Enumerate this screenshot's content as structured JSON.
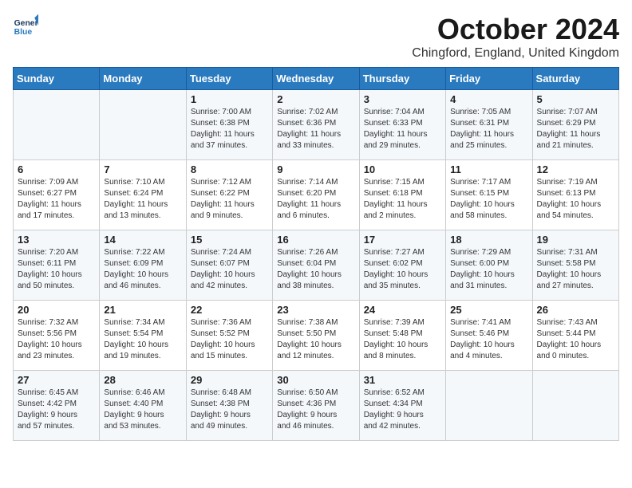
{
  "logo": {
    "line1": "General",
    "line2": "Blue"
  },
  "title": "October 2024",
  "location": "Chingford, England, United Kingdom",
  "days_of_week": [
    "Sunday",
    "Monday",
    "Tuesday",
    "Wednesday",
    "Thursday",
    "Friday",
    "Saturday"
  ],
  "weeks": [
    [
      {
        "day": "",
        "info": ""
      },
      {
        "day": "",
        "info": ""
      },
      {
        "day": "1",
        "info": "Sunrise: 7:00 AM\nSunset: 6:38 PM\nDaylight: 11 hours\nand 37 minutes."
      },
      {
        "day": "2",
        "info": "Sunrise: 7:02 AM\nSunset: 6:36 PM\nDaylight: 11 hours\nand 33 minutes."
      },
      {
        "day": "3",
        "info": "Sunrise: 7:04 AM\nSunset: 6:33 PM\nDaylight: 11 hours\nand 29 minutes."
      },
      {
        "day": "4",
        "info": "Sunrise: 7:05 AM\nSunset: 6:31 PM\nDaylight: 11 hours\nand 25 minutes."
      },
      {
        "day": "5",
        "info": "Sunrise: 7:07 AM\nSunset: 6:29 PM\nDaylight: 11 hours\nand 21 minutes."
      }
    ],
    [
      {
        "day": "6",
        "info": "Sunrise: 7:09 AM\nSunset: 6:27 PM\nDaylight: 11 hours\nand 17 minutes."
      },
      {
        "day": "7",
        "info": "Sunrise: 7:10 AM\nSunset: 6:24 PM\nDaylight: 11 hours\nand 13 minutes."
      },
      {
        "day": "8",
        "info": "Sunrise: 7:12 AM\nSunset: 6:22 PM\nDaylight: 11 hours\nand 9 minutes."
      },
      {
        "day": "9",
        "info": "Sunrise: 7:14 AM\nSunset: 6:20 PM\nDaylight: 11 hours\nand 6 minutes."
      },
      {
        "day": "10",
        "info": "Sunrise: 7:15 AM\nSunset: 6:18 PM\nDaylight: 11 hours\nand 2 minutes."
      },
      {
        "day": "11",
        "info": "Sunrise: 7:17 AM\nSunset: 6:15 PM\nDaylight: 10 hours\nand 58 minutes."
      },
      {
        "day": "12",
        "info": "Sunrise: 7:19 AM\nSunset: 6:13 PM\nDaylight: 10 hours\nand 54 minutes."
      }
    ],
    [
      {
        "day": "13",
        "info": "Sunrise: 7:20 AM\nSunset: 6:11 PM\nDaylight: 10 hours\nand 50 minutes."
      },
      {
        "day": "14",
        "info": "Sunrise: 7:22 AM\nSunset: 6:09 PM\nDaylight: 10 hours\nand 46 minutes."
      },
      {
        "day": "15",
        "info": "Sunrise: 7:24 AM\nSunset: 6:07 PM\nDaylight: 10 hours\nand 42 minutes."
      },
      {
        "day": "16",
        "info": "Sunrise: 7:26 AM\nSunset: 6:04 PM\nDaylight: 10 hours\nand 38 minutes."
      },
      {
        "day": "17",
        "info": "Sunrise: 7:27 AM\nSunset: 6:02 PM\nDaylight: 10 hours\nand 35 minutes."
      },
      {
        "day": "18",
        "info": "Sunrise: 7:29 AM\nSunset: 6:00 PM\nDaylight: 10 hours\nand 31 minutes."
      },
      {
        "day": "19",
        "info": "Sunrise: 7:31 AM\nSunset: 5:58 PM\nDaylight: 10 hours\nand 27 minutes."
      }
    ],
    [
      {
        "day": "20",
        "info": "Sunrise: 7:32 AM\nSunset: 5:56 PM\nDaylight: 10 hours\nand 23 minutes."
      },
      {
        "day": "21",
        "info": "Sunrise: 7:34 AM\nSunset: 5:54 PM\nDaylight: 10 hours\nand 19 minutes."
      },
      {
        "day": "22",
        "info": "Sunrise: 7:36 AM\nSunset: 5:52 PM\nDaylight: 10 hours\nand 15 minutes."
      },
      {
        "day": "23",
        "info": "Sunrise: 7:38 AM\nSunset: 5:50 PM\nDaylight: 10 hours\nand 12 minutes."
      },
      {
        "day": "24",
        "info": "Sunrise: 7:39 AM\nSunset: 5:48 PM\nDaylight: 10 hours\nand 8 minutes."
      },
      {
        "day": "25",
        "info": "Sunrise: 7:41 AM\nSunset: 5:46 PM\nDaylight: 10 hours\nand 4 minutes."
      },
      {
        "day": "26",
        "info": "Sunrise: 7:43 AM\nSunset: 5:44 PM\nDaylight: 10 hours\nand 0 minutes."
      }
    ],
    [
      {
        "day": "27",
        "info": "Sunrise: 6:45 AM\nSunset: 4:42 PM\nDaylight: 9 hours\nand 57 minutes."
      },
      {
        "day": "28",
        "info": "Sunrise: 6:46 AM\nSunset: 4:40 PM\nDaylight: 9 hours\nand 53 minutes."
      },
      {
        "day": "29",
        "info": "Sunrise: 6:48 AM\nSunset: 4:38 PM\nDaylight: 9 hours\nand 49 minutes."
      },
      {
        "day": "30",
        "info": "Sunrise: 6:50 AM\nSunset: 4:36 PM\nDaylight: 9 hours\nand 46 minutes."
      },
      {
        "day": "31",
        "info": "Sunrise: 6:52 AM\nSunset: 4:34 PM\nDaylight: 9 hours\nand 42 minutes."
      },
      {
        "day": "",
        "info": ""
      },
      {
        "day": "",
        "info": ""
      }
    ]
  ]
}
